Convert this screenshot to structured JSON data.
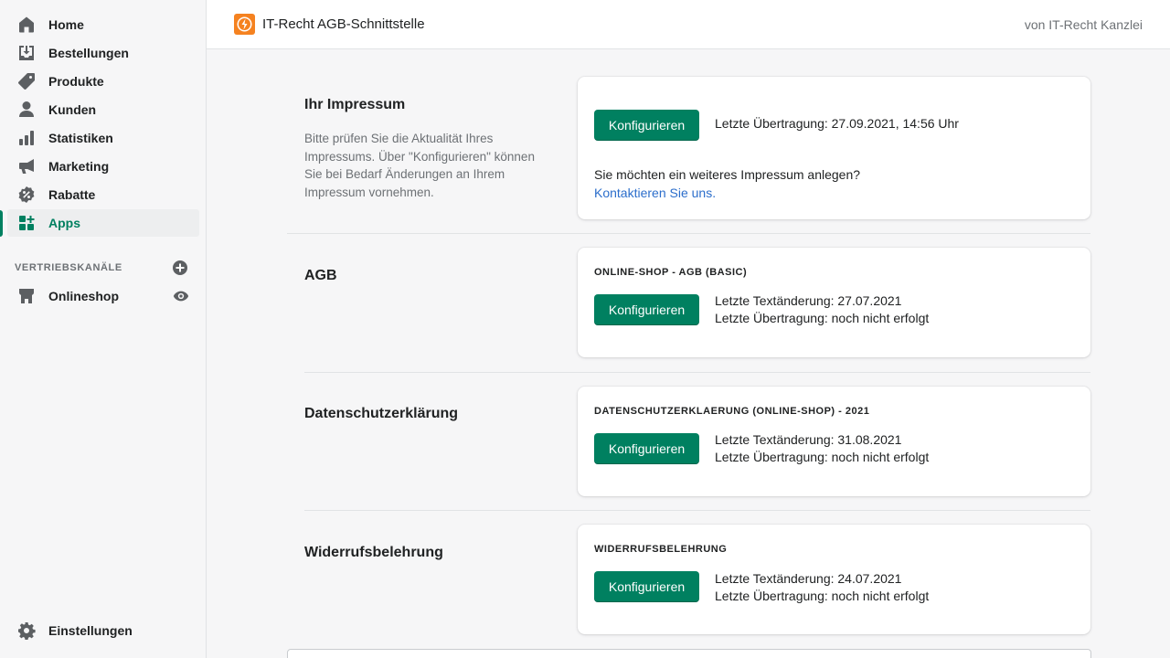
{
  "sidebar": {
    "items": [
      {
        "label": "Home",
        "icon": "home-icon"
      },
      {
        "label": "Bestellungen",
        "icon": "orders-icon"
      },
      {
        "label": "Produkte",
        "icon": "tag-icon"
      },
      {
        "label": "Kunden",
        "icon": "person-icon"
      },
      {
        "label": "Statistiken",
        "icon": "bar-chart-icon"
      },
      {
        "label": "Marketing",
        "icon": "megaphone-icon"
      },
      {
        "label": "Rabatte",
        "icon": "discount-icon"
      },
      {
        "label": "Apps",
        "icon": "apps-icon",
        "active": true
      }
    ],
    "channels_title": "VERTRIEBSKANÄLE",
    "channel": {
      "label": "Onlineshop",
      "icon": "store-icon"
    },
    "settings": {
      "label": "Einstellungen",
      "icon": "gear-icon"
    }
  },
  "topbar": {
    "app_title": "IT-Recht AGB-Schnittstelle",
    "vendor": "von IT-Recht Kanzlei"
  },
  "colors": {
    "accent": "#008060",
    "link": "#2c6ecb",
    "logo": "#f58220"
  },
  "sections": {
    "impressum": {
      "heading": "Ihr Impressum",
      "description": "Bitte prüfen Sie die Aktualität Ihres Impressums. Über \"Konfigurieren\" können Sie bei Bedarf Änderungen an Ihrem Impressum vornehmen.",
      "button": "Konfigurieren",
      "last_transfer": "Letzte Übertragung: 27.09.2021, 14:56 Uhr",
      "question": "Sie möchten ein weiteres Impressum anlegen?",
      "link": "Kontaktieren Sie uns."
    },
    "agb": {
      "heading": "AGB",
      "caption": "ONLINE-SHOP - AGB (BASIC)",
      "button": "Konfigurieren",
      "last_change": "Letzte Textänderung: 27.07.2021",
      "last_transfer": "Letzte Übertragung: noch nicht erfolgt"
    },
    "datenschutz": {
      "heading": "Datenschutzerklärung",
      "caption": "DATENSCHUTZERKLAERUNG (ONLINE-SHOP) - 2021",
      "button": "Konfigurieren",
      "last_change": "Letzte Textänderung: 31.08.2021",
      "last_transfer": "Letzte Übertragung: noch nicht erfolgt"
    },
    "widerruf": {
      "heading": "Widerrufsbelehrung",
      "caption": "WIDERRUFSBELEHRUNG",
      "button": "Konfigurieren",
      "last_change": "Letzte Textänderung: 24.07.2021",
      "last_transfer": "Letzte Übertragung: noch nicht erfolgt"
    }
  }
}
